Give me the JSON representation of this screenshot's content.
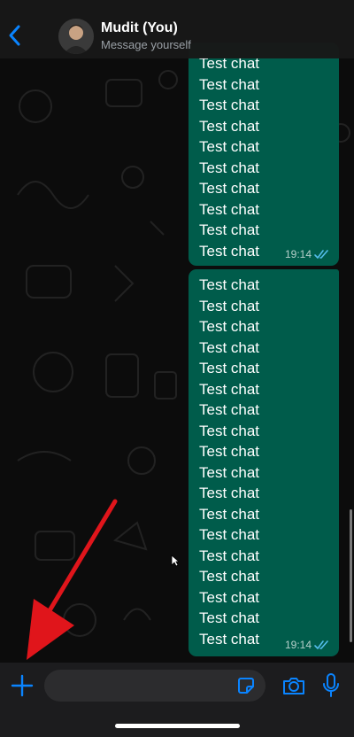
{
  "header": {
    "contact_name": "Mudit (You)",
    "contact_subtitle": "Message yourself",
    "back_icon": "chevron-left-icon"
  },
  "messages": [
    {
      "lines": [
        "Test chat",
        "Test chat",
        "Test chat",
        "Test chat",
        "Test chat",
        "Test chat",
        "Test chat",
        "Test chat",
        "Test chat",
        "Test chat"
      ],
      "time": "19:14",
      "status": "read"
    },
    {
      "lines": [
        "Test chat",
        "Test chat",
        "Test chat",
        "Test chat",
        "Test chat",
        "Test chat",
        "Test chat",
        "Test chat",
        "Test chat",
        "Test chat",
        "Test chat",
        "Test chat",
        "Test chat",
        "Test chat",
        "Test chat",
        "Test chat",
        "Test chat",
        "Test chat"
      ],
      "time": "19:14",
      "status": "read"
    }
  ],
  "composer": {
    "input_value": "",
    "placeholder": "",
    "icons": [
      "plus-icon",
      "sticker-icon",
      "camera-icon",
      "microphone-icon"
    ]
  },
  "colors": {
    "accent": "#0a84ff",
    "bubble_outgoing": "#005c4b",
    "read_ticks": "#53bdeb",
    "annotation_arrow": "#e0151b"
  }
}
